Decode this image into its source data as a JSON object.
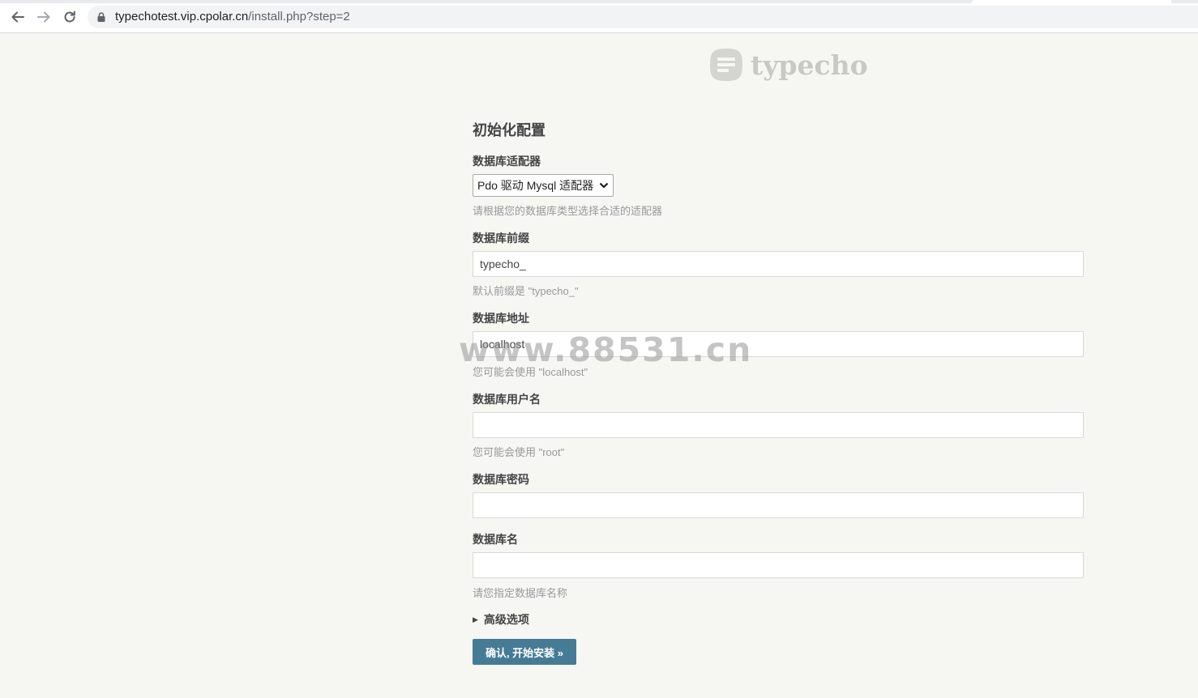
{
  "browser": {
    "url_host": "typechotest.vip.cpolar.cn",
    "url_path": "/install.php?step=2"
  },
  "logo": {
    "text": "typecho"
  },
  "form": {
    "title": "初始化配置",
    "adapter": {
      "label": "数据库适配器",
      "selected": "Pdo 驱动 Mysql 适配器",
      "hint": "请根据您的数据库类型选择合适的适配器"
    },
    "prefix": {
      "label": "数据库前缀",
      "value": "typecho_",
      "hint": "默认前缀是 \"typecho_\""
    },
    "host": {
      "label": "数据库地址",
      "value": "localhost",
      "hint": "您可能会使用 \"localhost\""
    },
    "user": {
      "label": "数据库用户名",
      "value": "",
      "hint": "您可能会使用 \"root\""
    },
    "password": {
      "label": "数据库密码",
      "value": ""
    },
    "dbname": {
      "label": "数据库名",
      "value": "",
      "hint": "请您指定数据库名称"
    },
    "advanced_label": "高级选项",
    "submit_label": "确认, 开始安装 »"
  },
  "watermark": "www.88531.cn",
  "colors": {
    "background": "#f6f6f3",
    "button": "#467b96",
    "hint": "#999999"
  }
}
